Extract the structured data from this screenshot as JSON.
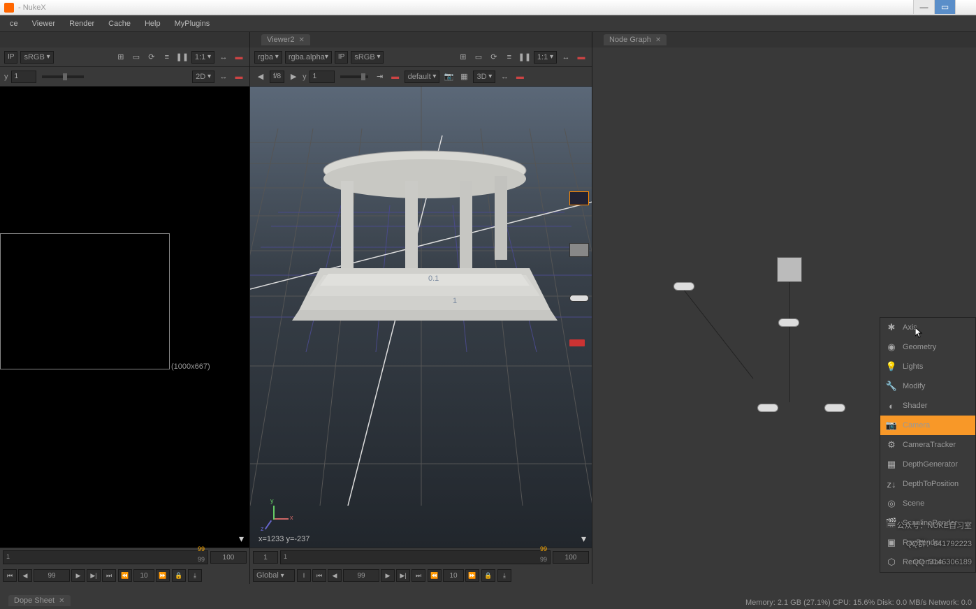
{
  "window": {
    "title": "- NukeX"
  },
  "menu": {
    "items": [
      "ce",
      "Viewer",
      "Render",
      "Cache",
      "Help",
      "MyPlugins"
    ]
  },
  "viewer1": {
    "ip": "IP",
    "srgb": "sRGB",
    "zoom": "1:1",
    "y": "y",
    "yval": "1",
    "mode": "2D",
    "dim": "(1000x667)"
  },
  "viewer2": {
    "tab": "Viewer2",
    "rgba": "rgba",
    "alpha": "rgba.alpha",
    "ip": "IP",
    "srgb": "sRGB",
    "zoom": "1:1",
    "fstop": "f/8",
    "y": "y",
    "yval": "1",
    "default": "default",
    "mode": "3D",
    "coord": "x=1233 y=-237",
    "label01": "0.1",
    "label1": "1"
  },
  "nodegraph": {
    "tab": "Node Graph"
  },
  "timeline": {
    "frame": "1",
    "end": "99",
    "cur": "99",
    "total": "100",
    "global": "Global",
    "j10": "10",
    "j99": "99"
  },
  "dope": {
    "label": "Dope Sheet"
  },
  "ctx": {
    "items": [
      {
        "icon": "✱",
        "label": "Axis"
      },
      {
        "icon": "◉",
        "label": "Geometry"
      },
      {
        "icon": "💡",
        "label": "Lights"
      },
      {
        "icon": "🔧",
        "label": "Modify"
      },
      {
        "icon": "◐",
        "label": "Shader"
      },
      {
        "icon": "📷",
        "label": "Camera",
        "sel": true
      },
      {
        "icon": "⚙",
        "label": "CameraTracker"
      },
      {
        "icon": "▦",
        "label": "DepthGenerator"
      },
      {
        "icon": "z↓",
        "label": "DepthToPosition"
      },
      {
        "icon": "◎",
        "label": "Scene"
      },
      {
        "icon": "🎬",
        "label": "ScanlineRender"
      },
      {
        "icon": "▣",
        "label": "RayRender"
      },
      {
        "icon": "⬡",
        "label": "RenderMan"
      }
    ]
  },
  "watermark": {
    "l1": "公众号：NUKE自习室",
    "l2": "QQ群：641792223",
    "l3": "QQ :3146306189"
  },
  "status": {
    "text": "Memory: 2.1 GB (27.1%) CPU: 15.6% Disk: 0.0 MB/s Network: 0.0"
  }
}
